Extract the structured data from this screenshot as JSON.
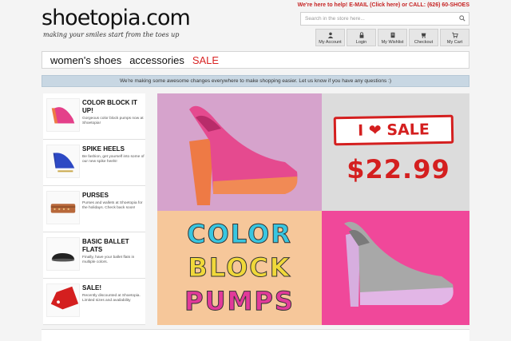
{
  "site": {
    "name": "shoetopia.com",
    "tagline": "making your smiles start from the toes up"
  },
  "header": {
    "help_text": "We're here to help! E-MAIL (Click here) or CALL: (626) 60-SHOES",
    "search_placeholder": "Search in the store here..."
  },
  "account_nav": [
    {
      "label": "My Account",
      "icon": "user-icon"
    },
    {
      "label": "Login",
      "icon": "lock-icon"
    },
    {
      "label": "My Wishlist",
      "icon": "wishlist-icon"
    },
    {
      "label": "Checkout",
      "icon": "checkout-icon"
    },
    {
      "label": "My Cart",
      "icon": "cart-icon"
    }
  ],
  "main_nav": {
    "items": [
      "women's shoes",
      "accessories",
      "SALE"
    ]
  },
  "banner_text": "We're making some awesome changes everywhere to make shopping easier. Let us know if you have any questions :)",
  "sidebar": {
    "items": [
      {
        "title": "COLOR BLOCK IT UP!",
        "description": "Gorgeous color block pumps now at Shoetopia!"
      },
      {
        "title": "SPIKE HEELS",
        "description": "Be fashion, get yourself into some of our new spike heels!"
      },
      {
        "title": "PURSES",
        "description": "Purses and wallets at Shoetopia for the holidays. Check back soon!"
      },
      {
        "title": "BASIC BALLET FLATS",
        "description": "Finally, have your ballet flats in multiple colors."
      },
      {
        "title": "SALE!",
        "description": "Recently discounted at Shoetopia. Limited sizes and availability"
      }
    ]
  },
  "promo": {
    "sale_label": "I ❤ SALE",
    "price": "$22.99",
    "title_lines": [
      "COLOR",
      "BLOCK",
      "PUMPS"
    ]
  },
  "colors": {
    "accent_red": "#d41f1f",
    "banner_blue": "#c8d7e3",
    "tile_purple": "#d6a3cc",
    "tile_pink": "#f0489a",
    "tile_peach": "#f6c79a"
  }
}
